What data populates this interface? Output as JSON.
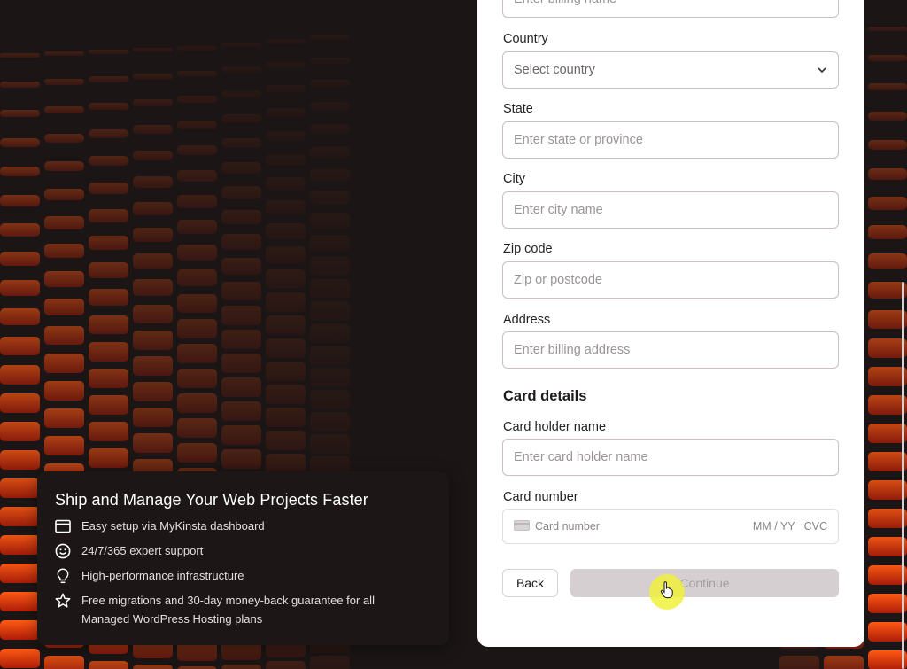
{
  "form": {
    "billing_name_placeholder": "Enter billing name",
    "country": {
      "label": "Country",
      "selected": "Select country"
    },
    "state": {
      "label": "State",
      "placeholder": "Enter state or province"
    },
    "city": {
      "label": "City",
      "placeholder": "Enter city name"
    },
    "zip": {
      "label": "Zip code",
      "placeholder": "Zip or postcode"
    },
    "address": {
      "label": "Address",
      "placeholder": "Enter billing address"
    },
    "card_details_heading": "Card details",
    "card_holder": {
      "label": "Card holder name",
      "placeholder": "Enter card holder name"
    },
    "card_number": {
      "label": "Card number",
      "placeholder": "Card number",
      "expiry": "MM / YY",
      "cvc": "CVC"
    },
    "back_label": "Back",
    "continue_label": "Continue"
  },
  "info": {
    "title": "Ship and Manage Your Web Projects Faster",
    "features": [
      {
        "icon": "browser-window-icon",
        "text": "Easy setup via MyKinsta dashboard"
      },
      {
        "icon": "smiley-icon",
        "text": "24/7/365 expert support"
      },
      {
        "icon": "lightbulb-icon",
        "text": "High-performance infrastructure"
      },
      {
        "icon": "star-icon",
        "text": "Free migrations and 30-day money-back guarantee for all Managed WordPress Hosting plans"
      }
    ]
  },
  "colors": {
    "accent": "#ff4a0a",
    "panel_bg": "#ffffff",
    "background": "#1b1515"
  }
}
